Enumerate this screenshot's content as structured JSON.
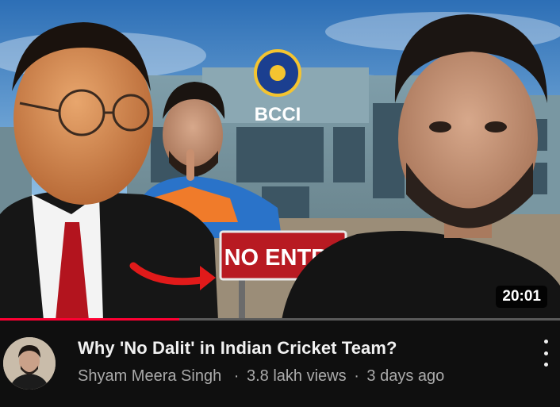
{
  "video": {
    "duration": "20:01",
    "watched_fraction": 0.32,
    "title": "Why 'No Dalit' in Indian Cricket Team?",
    "channel": "Shyam Meera Singh",
    "separator": "·",
    "views": "3.8 lakh views",
    "age": "3 days ago"
  },
  "thumbnail": {
    "building_sign": "BCCI",
    "board_text": "NO ENTRY"
  },
  "icons": {
    "menu": "more-vert-icon",
    "avatar": "channel-avatar"
  },
  "colors": {
    "progress": "#ff0033",
    "sign_red": "#b81a22",
    "background": "#0f0f0f"
  }
}
